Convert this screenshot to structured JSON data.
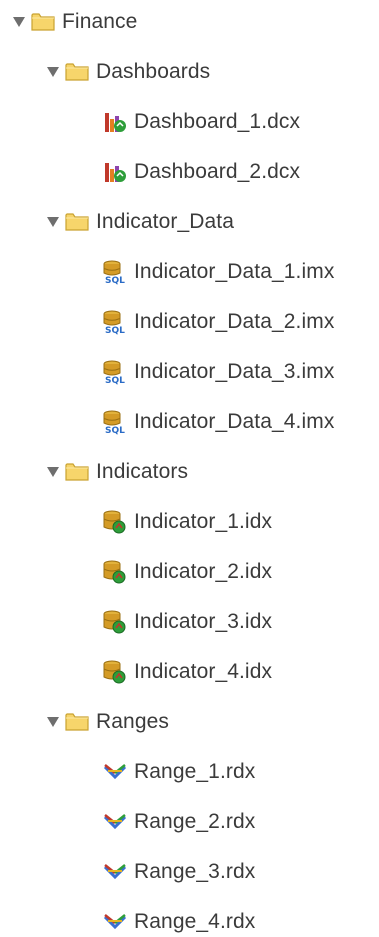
{
  "tree": {
    "root": {
      "label": "Finance",
      "icon": "folder-icon",
      "expanded": true
    },
    "folders": [
      {
        "label": "Dashboards",
        "icon": "folder-icon",
        "expanded": true,
        "items": [
          {
            "label": "Dashboard_1.dcx",
            "icon": "dashboard-file-icon"
          },
          {
            "label": "Dashboard_2.dcx",
            "icon": "dashboard-file-icon"
          }
        ]
      },
      {
        "label": "Indicator_Data",
        "icon": "folder-icon",
        "expanded": true,
        "items": [
          {
            "label": "Indicator_Data_1.imx",
            "icon": "sql-database-icon"
          },
          {
            "label": "Indicator_Data_2.imx",
            "icon": "sql-database-icon"
          },
          {
            "label": "Indicator_Data_3.imx",
            "icon": "sql-database-icon"
          },
          {
            "label": "Indicator_Data_4.imx",
            "icon": "sql-database-icon"
          }
        ]
      },
      {
        "label": "Indicators",
        "icon": "folder-icon",
        "expanded": true,
        "items": [
          {
            "label": "Indicator_1.idx",
            "icon": "indicator-database-icon"
          },
          {
            "label": "Indicator_2.idx",
            "icon": "indicator-database-icon"
          },
          {
            "label": "Indicator_3.idx",
            "icon": "indicator-database-icon"
          },
          {
            "label": "Indicator_4.idx",
            "icon": "indicator-database-icon"
          }
        ]
      },
      {
        "label": "Ranges",
        "icon": "folder-icon",
        "expanded": true,
        "items": [
          {
            "label": "Range_1.rdx",
            "icon": "range-icon"
          },
          {
            "label": "Range_2.rdx",
            "icon": "range-icon"
          },
          {
            "label": "Range_3.rdx",
            "icon": "range-icon"
          },
          {
            "label": "Range_4.rdx",
            "icon": "range-icon"
          }
        ]
      }
    ]
  },
  "colors": {
    "folder_fill": "#f7d56b",
    "folder_stroke": "#c9a230",
    "toggle": "#6e6e6e",
    "text": "#3b3b3b"
  }
}
